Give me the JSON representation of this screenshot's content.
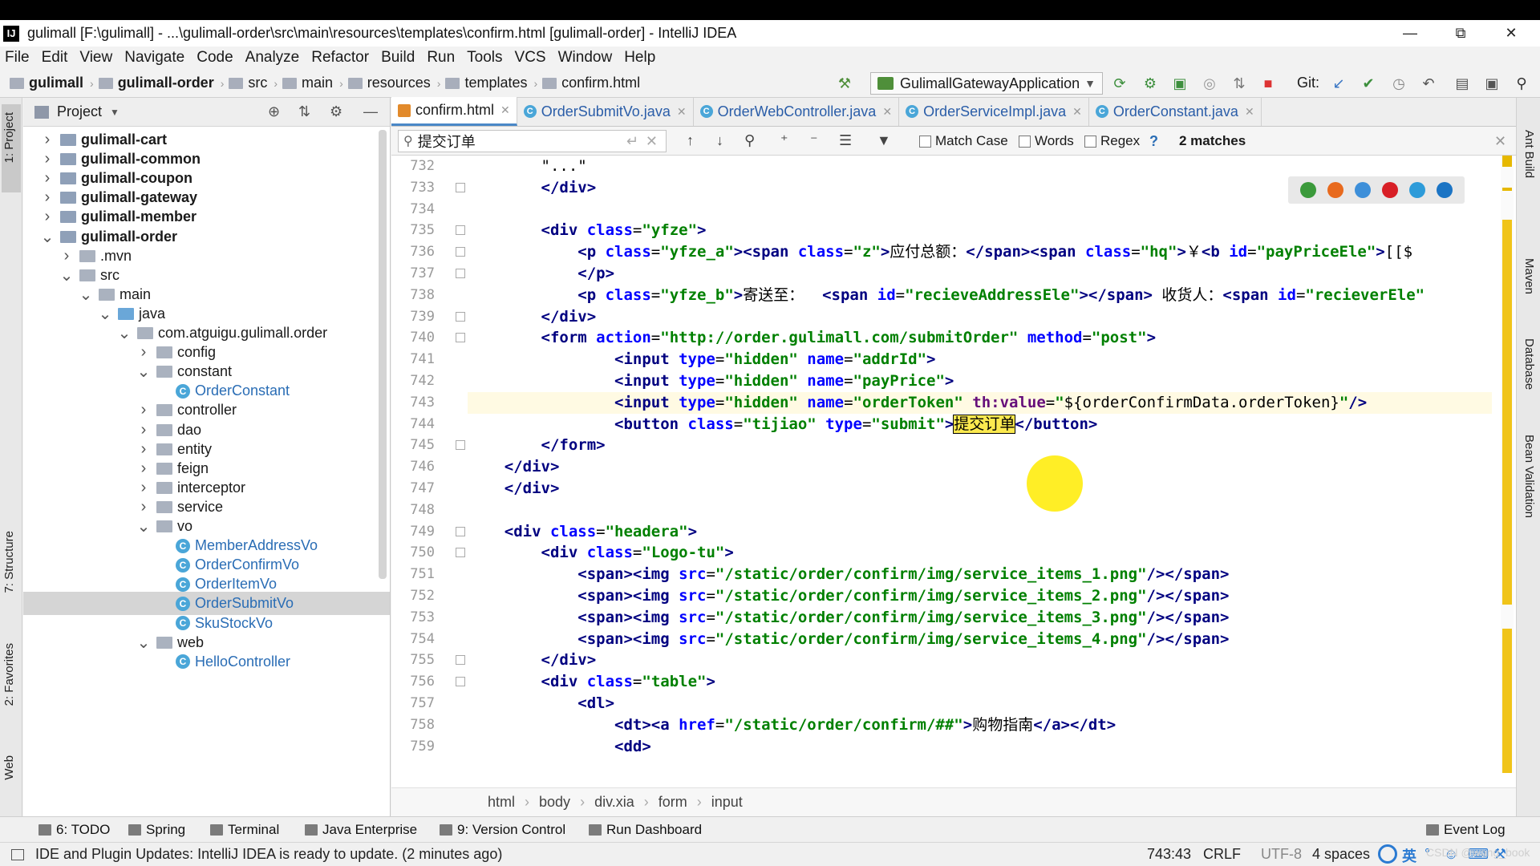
{
  "window": {
    "title": "gulimall [F:\\gulimall] - ...\\gulimall-order\\src\\main\\resources\\templates\\confirm.html [gulimall-order] - IntelliJ IDEA",
    "app_icon": "IJ"
  },
  "menu": [
    "File",
    "Edit",
    "View",
    "Navigate",
    "Code",
    "Analyze",
    "Refactor",
    "Build",
    "Run",
    "Tools",
    "VCS",
    "Window",
    "Help"
  ],
  "nav": {
    "crumbs": [
      "gulimall",
      "gulimall-order",
      "src",
      "main",
      "resources",
      "templates",
      "confirm.html"
    ],
    "run_config": "GulimallGatewayApplication",
    "git_label": "Git:"
  },
  "project": {
    "title": "Project",
    "tree": [
      {
        "label": "gulimall-cart",
        "depth": 0,
        "arrow": "right",
        "kind": "module",
        "bold": true
      },
      {
        "label": "gulimall-common",
        "depth": 0,
        "arrow": "right",
        "kind": "module",
        "bold": true
      },
      {
        "label": "gulimall-coupon",
        "depth": 0,
        "arrow": "right",
        "kind": "module",
        "bold": true
      },
      {
        "label": "gulimall-gateway",
        "depth": 0,
        "arrow": "right",
        "kind": "module",
        "bold": true
      },
      {
        "label": "gulimall-member",
        "depth": 0,
        "arrow": "right",
        "kind": "module",
        "bold": true
      },
      {
        "label": "gulimall-order",
        "depth": 0,
        "arrow": "down",
        "kind": "module",
        "bold": true
      },
      {
        "label": ".mvn",
        "depth": 1,
        "arrow": "right",
        "kind": "folder"
      },
      {
        "label": "src",
        "depth": 1,
        "arrow": "down",
        "kind": "folder"
      },
      {
        "label": "main",
        "depth": 2,
        "arrow": "down",
        "kind": "folder"
      },
      {
        "label": "java",
        "depth": 3,
        "arrow": "down",
        "kind": "java"
      },
      {
        "label": "com.atguigu.gulimall.order",
        "depth": 4,
        "arrow": "down",
        "kind": "folder"
      },
      {
        "label": "config",
        "depth": 5,
        "arrow": "right",
        "kind": "folder"
      },
      {
        "label": "constant",
        "depth": 5,
        "arrow": "down",
        "kind": "folder"
      },
      {
        "label": "OrderConstant",
        "depth": 6,
        "arrow": "",
        "kind": "class"
      },
      {
        "label": "controller",
        "depth": 5,
        "arrow": "right",
        "kind": "folder"
      },
      {
        "label": "dao",
        "depth": 5,
        "arrow": "right",
        "kind": "folder"
      },
      {
        "label": "entity",
        "depth": 5,
        "arrow": "right",
        "kind": "folder"
      },
      {
        "label": "feign",
        "depth": 5,
        "arrow": "right",
        "kind": "folder"
      },
      {
        "label": "interceptor",
        "depth": 5,
        "arrow": "right",
        "kind": "folder"
      },
      {
        "label": "service",
        "depth": 5,
        "arrow": "right",
        "kind": "folder"
      },
      {
        "label": "vo",
        "depth": 5,
        "arrow": "down",
        "kind": "folder"
      },
      {
        "label": "MemberAddressVo",
        "depth": 6,
        "arrow": "",
        "kind": "class"
      },
      {
        "label": "OrderConfirmVo",
        "depth": 6,
        "arrow": "",
        "kind": "class"
      },
      {
        "label": "OrderItemVo",
        "depth": 6,
        "arrow": "",
        "kind": "class"
      },
      {
        "label": "OrderSubmitVo",
        "depth": 6,
        "arrow": "",
        "kind": "class",
        "selected": true
      },
      {
        "label": "SkuStockVo",
        "depth": 6,
        "arrow": "",
        "kind": "class"
      },
      {
        "label": "web",
        "depth": 5,
        "arrow": "down",
        "kind": "folder"
      },
      {
        "label": "HelloController",
        "depth": 6,
        "arrow": "",
        "kind": "class"
      }
    ]
  },
  "left_strip": [
    "1: Project",
    "7: Structure",
    "2: Favorites",
    "Web"
  ],
  "right_strip": [
    "Ant Build",
    "Maven",
    "Database",
    "Bean Validation"
  ],
  "tabs": [
    {
      "label": "confirm.html",
      "icon": "html-icon",
      "active": true
    },
    {
      "label": "OrderSubmitVo.java",
      "icon": "class-icon",
      "active": false
    },
    {
      "label": "OrderWebController.java",
      "icon": "class-icon",
      "active": false
    },
    {
      "label": "OrderServiceImpl.java",
      "icon": "class-icon",
      "active": false
    },
    {
      "label": "OrderConstant.java",
      "icon": "class-icon",
      "active": false
    }
  ],
  "search": {
    "query": "提交订单",
    "match_case": "Match Case",
    "words": "Words",
    "regex": "Regex",
    "help": "?",
    "matches": "2 matches"
  },
  "gutter": [
    "732",
    "733",
    "734",
    "735",
    "736",
    "737",
    "738",
    "739",
    "740",
    "741",
    "742",
    "743",
    "744",
    "745",
    "746",
    "747",
    "748",
    "749",
    "750",
    "751",
    "752",
    "753",
    "754",
    "755",
    "756",
    "757",
    "758",
    "759"
  ],
  "code": [
    {
      "parts": [
        [
          "x",
          "        \"...\""
        ]
      ]
    },
    {
      "parts": [
        [
          "t",
          "        </div>"
        ]
      ]
    },
    {
      "parts": [
        [
          "x",
          ""
        ]
      ]
    },
    {
      "parts": [
        [
          "t",
          "        <div "
        ],
        [
          "a",
          "class"
        ],
        [
          "x",
          "="
        ],
        [
          "v",
          "\"yfze\""
        ],
        [
          "t",
          ">"
        ]
      ]
    },
    {
      "parts": [
        [
          "t",
          "            <p "
        ],
        [
          "a",
          "class"
        ],
        [
          "x",
          "="
        ],
        [
          "v",
          "\"yfze_a\""
        ],
        [
          "t",
          "><span "
        ],
        [
          "a",
          "class"
        ],
        [
          "x",
          "="
        ],
        [
          "v",
          "\"z\""
        ],
        [
          "t",
          ">"
        ],
        [
          "x",
          "应付总额："
        ],
        [
          "t",
          "</span><span "
        ],
        [
          "a",
          "class"
        ],
        [
          "x",
          "="
        ],
        [
          "v",
          "\"hq\""
        ],
        [
          "t",
          ">"
        ],
        [
          "x",
          "￥"
        ],
        [
          "t",
          "<b "
        ],
        [
          "a",
          "id"
        ],
        [
          "x",
          "="
        ],
        [
          "v",
          "\"payPriceEle\""
        ],
        [
          "t",
          ">"
        ],
        [
          "x",
          "[[$"
        ]
      ]
    },
    {
      "parts": [
        [
          "t",
          "            </p>"
        ]
      ]
    },
    {
      "parts": [
        [
          "t",
          "            <p "
        ],
        [
          "a",
          "class"
        ],
        [
          "x",
          "="
        ],
        [
          "v",
          "\"yfze_b\""
        ],
        [
          "t",
          ">"
        ],
        [
          "x",
          "寄送至：  "
        ],
        [
          "t",
          "<span "
        ],
        [
          "a",
          "id"
        ],
        [
          "x",
          "="
        ],
        [
          "v",
          "\"recieveAddressEle\""
        ],
        [
          "t",
          "></span>"
        ],
        [
          "x",
          " 收货人："
        ],
        [
          "t",
          "<span "
        ],
        [
          "a",
          "id"
        ],
        [
          "x",
          "="
        ],
        [
          "v",
          "\"recieverEle\""
        ]
      ]
    },
    {
      "parts": [
        [
          "t",
          "        </div>"
        ]
      ]
    },
    {
      "parts": [
        [
          "t",
          "        <form "
        ],
        [
          "a",
          "action"
        ],
        [
          "x",
          "="
        ],
        [
          "v",
          "\"http://order.gulimall.com/submitOrder\""
        ],
        [
          "x",
          " "
        ],
        [
          "a",
          "method"
        ],
        [
          "x",
          "="
        ],
        [
          "v",
          "\"post\""
        ],
        [
          "t",
          ">"
        ]
      ]
    },
    {
      "parts": [
        [
          "t",
          "                <input "
        ],
        [
          "a",
          "type"
        ],
        [
          "x",
          "="
        ],
        [
          "v",
          "\"hidden\""
        ],
        [
          "x",
          " "
        ],
        [
          "a",
          "name"
        ],
        [
          "x",
          "="
        ],
        [
          "v",
          "\"addrId\""
        ],
        [
          "t",
          ">"
        ]
      ]
    },
    {
      "parts": [
        [
          "t",
          "                <input "
        ],
        [
          "a",
          "type"
        ],
        [
          "x",
          "="
        ],
        [
          "v",
          "\"hidden\""
        ],
        [
          "x",
          " "
        ],
        [
          "a",
          "name"
        ],
        [
          "x",
          "="
        ],
        [
          "v",
          "\"payPrice\""
        ],
        [
          "t",
          ">"
        ]
      ]
    },
    {
      "parts": [
        [
          "t",
          "                <input "
        ],
        [
          "a",
          "type"
        ],
        [
          "x",
          "="
        ],
        [
          "v",
          "\"hidden\""
        ],
        [
          "x",
          " "
        ],
        [
          "a",
          "name"
        ],
        [
          "x",
          "="
        ],
        [
          "v",
          "\"orderToken\""
        ],
        [
          "x",
          " "
        ],
        [
          "th",
          "th:value"
        ],
        [
          "x",
          "="
        ],
        [
          "v",
          "\""
        ],
        [
          "x",
          "${orderConfirmData.orderToken}"
        ],
        [
          "v",
          "\""
        ],
        [
          "t",
          "/>"
        ]
      ],
      "current": true
    },
    {
      "parts": [
        [
          "t",
          "                <button "
        ],
        [
          "a",
          "class"
        ],
        [
          "x",
          "="
        ],
        [
          "v",
          "\"tijiao\""
        ],
        [
          "x",
          " "
        ],
        [
          "a",
          "type"
        ],
        [
          "x",
          "="
        ],
        [
          "v",
          "\"submit\""
        ],
        [
          "t",
          ">"
        ],
        [
          "found",
          "提交订单"
        ],
        [
          "t",
          "</button>"
        ]
      ]
    },
    {
      "parts": [
        [
          "t",
          "        </form>"
        ]
      ]
    },
    {
      "parts": [
        [
          "t",
          "    </div>"
        ]
      ]
    },
    {
      "parts": [
        [
          "t",
          "    </div>"
        ]
      ]
    },
    {
      "parts": [
        [
          "x",
          ""
        ]
      ]
    },
    {
      "parts": [
        [
          "t",
          "    <div "
        ],
        [
          "a",
          "class"
        ],
        [
          "x",
          "="
        ],
        [
          "v",
          "\"headera\""
        ],
        [
          "t",
          ">"
        ]
      ]
    },
    {
      "parts": [
        [
          "t",
          "        <div "
        ],
        [
          "a",
          "class"
        ],
        [
          "x",
          "="
        ],
        [
          "v",
          "\"Logo-tu\""
        ],
        [
          "t",
          ">"
        ]
      ]
    },
    {
      "parts": [
        [
          "t",
          "            <span><img "
        ],
        [
          "a",
          "src"
        ],
        [
          "x",
          "="
        ],
        [
          "v",
          "\"/static/order/confirm/img/service_items_1.png\""
        ],
        [
          "t",
          "/></span>"
        ]
      ]
    },
    {
      "parts": [
        [
          "t",
          "            <span><img "
        ],
        [
          "a",
          "src"
        ],
        [
          "x",
          "="
        ],
        [
          "v",
          "\"/static/order/confirm/img/service_items_2.png\""
        ],
        [
          "t",
          "/></span>"
        ]
      ]
    },
    {
      "parts": [
        [
          "t",
          "            <span><img "
        ],
        [
          "a",
          "src"
        ],
        [
          "x",
          "="
        ],
        [
          "v",
          "\"/static/order/confirm/img/service_items_3.png\""
        ],
        [
          "t",
          "/></span>"
        ]
      ]
    },
    {
      "parts": [
        [
          "t",
          "            <span><img "
        ],
        [
          "a",
          "src"
        ],
        [
          "x",
          "="
        ],
        [
          "v",
          "\"/static/order/confirm/img/service_items_4.png\""
        ],
        [
          "t",
          "/></span>"
        ]
      ]
    },
    {
      "parts": [
        [
          "t",
          "        </div>"
        ]
      ]
    },
    {
      "parts": [
        [
          "t",
          "        <div "
        ],
        [
          "a",
          "class"
        ],
        [
          "x",
          "="
        ],
        [
          "v",
          "\"table\""
        ],
        [
          "t",
          ">"
        ]
      ]
    },
    {
      "parts": [
        [
          "t",
          "            <dl>"
        ]
      ]
    },
    {
      "parts": [
        [
          "t",
          "                <dt><a "
        ],
        [
          "a",
          "href"
        ],
        [
          "x",
          "="
        ],
        [
          "v",
          "\"/static/order/confirm/##\""
        ],
        [
          "t",
          ">"
        ],
        [
          "x",
          "购物指南"
        ],
        [
          "t",
          "</a></dt>"
        ]
      ]
    },
    {
      "parts": [
        [
          "t",
          "                <dd>"
        ]
      ]
    }
  ],
  "editor_breadcrumb": [
    "html",
    "body",
    "div.xia",
    "form",
    "input"
  ],
  "tool_windows": [
    "6: TODO",
    "Spring",
    "Terminal",
    "Java Enterprise",
    "9: Version Control",
    "Run Dashboard",
    "Event Log"
  ],
  "status": {
    "message": "IDE and Plugin Updates: IntelliJ IDEA is ready to update. (2 minutes ago)",
    "position": "743:43",
    "line_sep": "CRLF",
    "encoding": "UTF-8",
    "indent": "4 spaces",
    "ime": "英"
  },
  "watermark": "CSDN @wang_book",
  "colors": {
    "accent": "#4a88c7",
    "search_hit": "#fce94f",
    "tag": "#000080",
    "attr": "#0000ff",
    "string": "#008000"
  }
}
